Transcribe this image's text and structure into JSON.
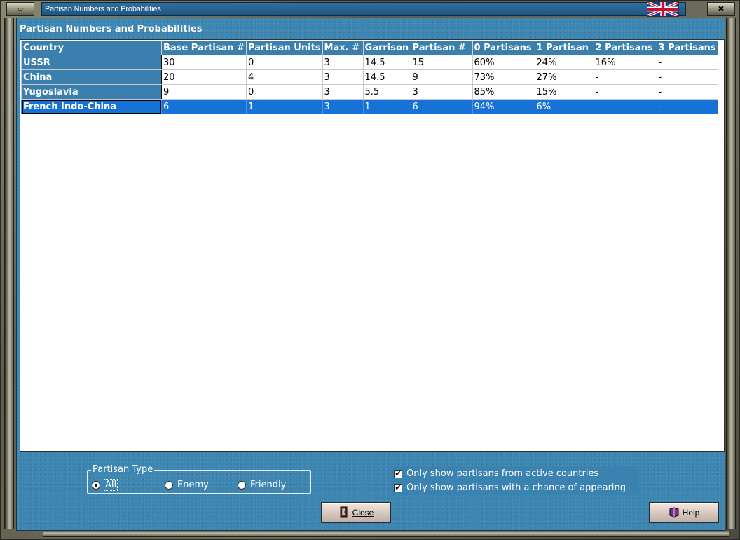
{
  "window": {
    "title": "Partisan Numbers and Probabilities",
    "menu_glyph": "▱",
    "close_glyph": "✖"
  },
  "panel": {
    "title": "Partisan Numbers and Probabilities"
  },
  "table": {
    "columns": [
      "Country",
      "Base Partisan #",
      "Partisan Units",
      "Max. #",
      "Garrison",
      "Partisan #",
      "0 Partisans",
      "1 Partisan",
      "2 Partisans",
      "3 Partisans"
    ],
    "rows": [
      [
        "USSR",
        "30",
        "0",
        "3",
        "14.5",
        "15",
        "60%",
        "24%",
        "16%",
        "-"
      ],
      [
        "China",
        "20",
        "4",
        "3",
        "14.5",
        "9",
        "73%",
        "27%",
        "-",
        "-"
      ],
      [
        "Yugoslavia",
        "9",
        "0",
        "3",
        "5.5",
        "3",
        "85%",
        "15%",
        "-",
        "-"
      ],
      [
        "French Indo-China",
        "6",
        "1",
        "3",
        "1",
        "6",
        "94%",
        "6%",
        "-",
        "-"
      ]
    ],
    "selected_row": 3
  },
  "partisan_type": {
    "legend": "Partisan Type",
    "options": [
      "All",
      "Enemy",
      "Friendly"
    ],
    "selected": "All"
  },
  "filters": {
    "active_countries": {
      "label": "Only show partisans from active countries",
      "checked": true
    },
    "chance_appearing": {
      "label": "Only show partisans with a chance of appearing",
      "checked": true
    }
  },
  "buttons": {
    "close": "Close",
    "help": "Help"
  },
  "colors": {
    "panel": "#3d86b2",
    "header": "#3a7fae",
    "selection": "#1672d6",
    "titlebar": "#2f6f9e"
  },
  "icons": {
    "close": "door-exit-icon",
    "help": "book-icon",
    "flag": "uk-flag-icon"
  }
}
